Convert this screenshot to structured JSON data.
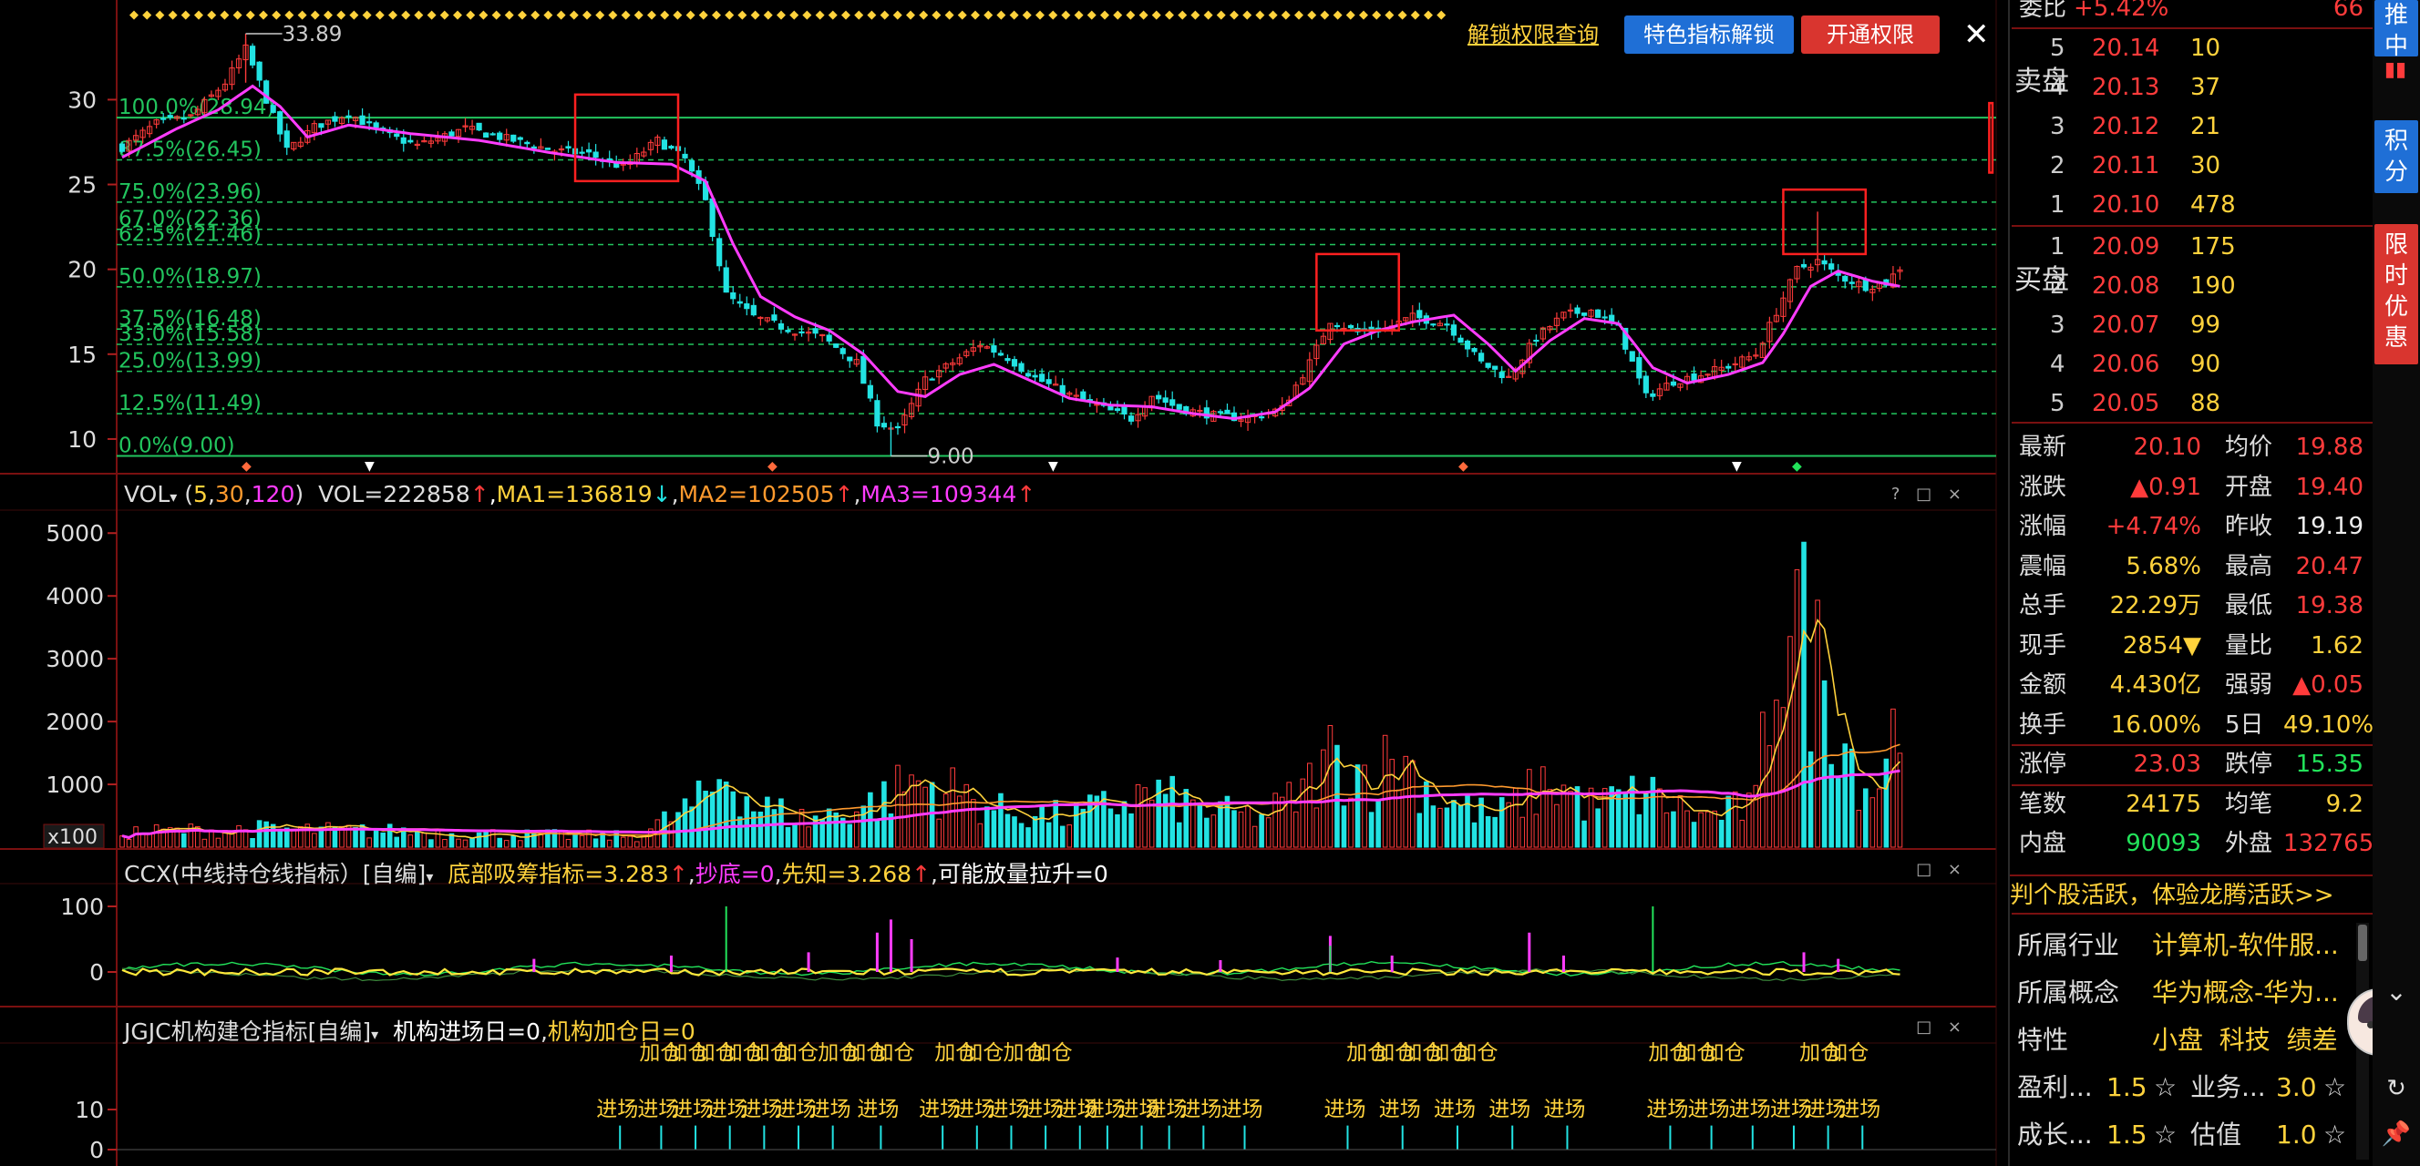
{
  "chart_data": [
    {
      "type": "candlestick",
      "title": "",
      "y_ticks": [
        10,
        15,
        20,
        25,
        30
      ],
      "ylim": [
        8.6,
        34.8
      ],
      "grid": false,
      "price_high_label": "33.89",
      "price_low_label": "9.00",
      "fib_levels": [
        {
          "label": "100.0%(28.94)",
          "value": 28.94
        },
        {
          "label": "87.5%(26.45)",
          "value": 26.45
        },
        {
          "label": "75.0%(23.96)",
          "value": 23.96
        },
        {
          "label": "67.0%(22.36)",
          "value": 22.36
        },
        {
          "label": "62.5%(21.46)",
          "value": 21.46
        },
        {
          "label": "50.0%(18.97)",
          "value": 18.97
        },
        {
          "label": "37.5%(16.48)",
          "value": 16.48
        },
        {
          "label": "33.0%(15.58)",
          "value": 15.58
        },
        {
          "label": "25.0%(13.99)",
          "value": 13.99
        },
        {
          "label": "12.5%(11.49)",
          "value": 11.49
        },
        {
          "label": "0.0%(9.00)",
          "value": 9.0
        }
      ],
      "close_approx": [
        {
          "i": 0,
          "v": 27.2
        },
        {
          "i": 5,
          "v": 28.6
        },
        {
          "i": 10,
          "v": 29.0
        },
        {
          "i": 15,
          "v": 31.0
        },
        {
          "i": 18,
          "v": 33.0
        },
        {
          "i": 21,
          "v": 30.0
        },
        {
          "i": 24,
          "v": 27.0
        },
        {
          "i": 28,
          "v": 28.4
        },
        {
          "i": 33,
          "v": 29.2
        },
        {
          "i": 38,
          "v": 28.0
        },
        {
          "i": 43,
          "v": 27.3
        },
        {
          "i": 50,
          "v": 28.3
        },
        {
          "i": 57,
          "v": 27.6
        },
        {
          "i": 63,
          "v": 27.0
        },
        {
          "i": 68,
          "v": 26.8
        },
        {
          "i": 73,
          "v": 26.0
        },
        {
          "i": 78,
          "v": 27.6
        },
        {
          "i": 82,
          "v": 26.5
        },
        {
          "i": 85,
          "v": 24.0
        },
        {
          "i": 88,
          "v": 18.5
        },
        {
          "i": 92,
          "v": 17.2
        },
        {
          "i": 97,
          "v": 16.5
        },
        {
          "i": 102,
          "v": 16.0
        },
        {
          "i": 107,
          "v": 14.5
        },
        {
          "i": 110,
          "v": 11.0
        },
        {
          "i": 113,
          "v": 10.5
        },
        {
          "i": 117,
          "v": 13.5
        },
        {
          "i": 121,
          "v": 14.5
        },
        {
          "i": 125,
          "v": 15.6
        },
        {
          "i": 129,
          "v": 14.8
        },
        {
          "i": 133,
          "v": 13.6
        },
        {
          "i": 138,
          "v": 12.6
        },
        {
          "i": 143,
          "v": 11.8
        },
        {
          "i": 147,
          "v": 11.2
        },
        {
          "i": 150,
          "v": 12.6
        },
        {
          "i": 154,
          "v": 11.8
        },
        {
          "i": 159,
          "v": 11.4
        },
        {
          "i": 164,
          "v": 11.2
        },
        {
          "i": 169,
          "v": 11.8
        },
        {
          "i": 173,
          "v": 14.5
        },
        {
          "i": 176,
          "v": 17.0
        },
        {
          "i": 180,
          "v": 16.3
        },
        {
          "i": 184,
          "v": 16.5
        },
        {
          "i": 188,
          "v": 17.2
        },
        {
          "i": 193,
          "v": 16.8
        },
        {
          "i": 198,
          "v": 14.5
        },
        {
          "i": 202,
          "v": 13.6
        },
        {
          "i": 206,
          "v": 16.0
        },
        {
          "i": 210,
          "v": 17.3
        },
        {
          "i": 214,
          "v": 17.6
        },
        {
          "i": 218,
          "v": 16.5
        },
        {
          "i": 222,
          "v": 12.5
        },
        {
          "i": 226,
          "v": 13.4
        },
        {
          "i": 230,
          "v": 13.8
        },
        {
          "i": 234,
          "v": 14.3
        },
        {
          "i": 238,
          "v": 15.0
        },
        {
          "i": 241,
          "v": 17.5
        },
        {
          "i": 244,
          "v": 20.0
        },
        {
          "i": 247,
          "v": 20.5
        },
        {
          "i": 250,
          "v": 19.6
        },
        {
          "i": 254,
          "v": 19.0
        },
        {
          "i": 257,
          "v": 19.2
        },
        {
          "i": 259,
          "v": 20.1
        }
      ],
      "ma_approx": [
        {
          "i": 0,
          "v": 26.6
        },
        {
          "i": 8,
          "v": 28.3
        },
        {
          "i": 14,
          "v": 29.4
        },
        {
          "i": 19,
          "v": 30.8
        },
        {
          "i": 23,
          "v": 29.6
        },
        {
          "i": 27,
          "v": 27.8
        },
        {
          "i": 33,
          "v": 28.5
        },
        {
          "i": 42,
          "v": 28.0
        },
        {
          "i": 52,
          "v": 27.6
        },
        {
          "i": 62,
          "v": 26.9
        },
        {
          "i": 72,
          "v": 26.3
        },
        {
          "i": 80,
          "v": 26.2
        },
        {
          "i": 85,
          "v": 25.2
        },
        {
          "i": 89,
          "v": 21.5
        },
        {
          "i": 93,
          "v": 18.4
        },
        {
          "i": 98,
          "v": 17.2
        },
        {
          "i": 103,
          "v": 16.4
        },
        {
          "i": 108,
          "v": 15.0
        },
        {
          "i": 113,
          "v": 12.8
        },
        {
          "i": 117,
          "v": 12.5
        },
        {
          "i": 122,
          "v": 13.8
        },
        {
          "i": 127,
          "v": 14.4
        },
        {
          "i": 132,
          "v": 13.5
        },
        {
          "i": 138,
          "v": 12.4
        },
        {
          "i": 144,
          "v": 12.0
        },
        {
          "i": 150,
          "v": 11.9
        },
        {
          "i": 156,
          "v": 11.5
        },
        {
          "i": 162,
          "v": 11.2
        },
        {
          "i": 168,
          "v": 11.6
        },
        {
          "i": 173,
          "v": 13.0
        },
        {
          "i": 178,
          "v": 15.6
        },
        {
          "i": 183,
          "v": 16.4
        },
        {
          "i": 188,
          "v": 16.9
        },
        {
          "i": 194,
          "v": 17.3
        },
        {
          "i": 199,
          "v": 15.6
        },
        {
          "i": 203,
          "v": 14.0
        },
        {
          "i": 208,
          "v": 15.8
        },
        {
          "i": 213,
          "v": 17.1
        },
        {
          "i": 218,
          "v": 16.8
        },
        {
          "i": 223,
          "v": 14.2
        },
        {
          "i": 228,
          "v": 13.3
        },
        {
          "i": 234,
          "v": 13.8
        },
        {
          "i": 239,
          "v": 14.5
        },
        {
          "i": 242,
          "v": 16.2
        },
        {
          "i": 246,
          "v": 19.0
        },
        {
          "i": 250,
          "v": 19.9
        },
        {
          "i": 255,
          "v": 19.3
        },
        {
          "i": 259,
          "v": 19.0
        }
      ],
      "n_bars": 260
    },
    {
      "type": "bar",
      "name": "VOL",
      "y_ticks": [
        1000,
        2000,
        3000,
        4000,
        5000
      ],
      "ylim": [
        0,
        5250
      ],
      "unit_label": "x100",
      "vol_approx": [
        {
          "i": 0,
          "v": 250
        },
        {
          "i": 20,
          "v": 300
        },
        {
          "i": 40,
          "v": 260
        },
        {
          "i": 60,
          "v": 200
        },
        {
          "i": 75,
          "v": 180
        },
        {
          "i": 85,
          "v": 800
        },
        {
          "i": 88,
          "v": 1300
        },
        {
          "i": 92,
          "v": 700
        },
        {
          "i": 100,
          "v": 450
        },
        {
          "i": 110,
          "v": 750
        },
        {
          "i": 115,
          "v": 1100
        },
        {
          "i": 122,
          "v": 900
        },
        {
          "i": 128,
          "v": 600
        },
        {
          "i": 138,
          "v": 500
        },
        {
          "i": 150,
          "v": 900
        },
        {
          "i": 158,
          "v": 600
        },
        {
          "i": 166,
          "v": 500
        },
        {
          "i": 172,
          "v": 900
        },
        {
          "i": 176,
          "v": 1500
        },
        {
          "i": 182,
          "v": 1200
        },
        {
          "i": 186,
          "v": 1500
        },
        {
          "i": 192,
          "v": 800
        },
        {
          "i": 200,
          "v": 500
        },
        {
          "i": 208,
          "v": 1100
        },
        {
          "i": 214,
          "v": 700
        },
        {
          "i": 222,
          "v": 900
        },
        {
          "i": 230,
          "v": 500
        },
        {
          "i": 238,
          "v": 700
        },
        {
          "i": 241,
          "v": 3500
        },
        {
          "i": 243,
          "v": 4200
        },
        {
          "i": 246,
          "v": 3200
        },
        {
          "i": 249,
          "v": 2600
        },
        {
          "i": 252,
          "v": 1500
        },
        {
          "i": 255,
          "v": 900
        },
        {
          "i": 258,
          "v": 1900
        },
        {
          "i": 259,
          "v": 2200
        }
      ]
    }
  ],
  "header": {
    "buttons": {
      "query": "解锁权限查询",
      "unlock": "特色指标解锁",
      "open": "开通权限",
      "close": "✕"
    }
  },
  "vol_header": {
    "name": "VOL",
    "params_open": "(",
    "p1": "5",
    "comma1": ",",
    "p2": "30",
    "comma2": ",",
    "p3": "120",
    "params_close": ")",
    "vol": "VOL=222858",
    "vol_arrow": "↑",
    "ma1": "MA1=136819",
    "ma1_arrow": "↓",
    "ma2": "MA2=102505",
    "ma2_arrow": "↑",
    "ma3": "MA3=109344",
    "ma3_arrow": "↑",
    "controls": "? □ ×"
  },
  "ccx_header": {
    "name": "CCX(中线持仓线指标）[自编]",
    "v1": "底部吸筹指标=3.283",
    "v1_arrow": "↑",
    "v2": "抄底=0",
    "v3": "先知=3.268",
    "v3_arrow": "↑",
    "v4": "可能放量拉升=0",
    "y_ticks": [
      "100",
      "0"
    ],
    "controls": "□ ×"
  },
  "jgjc_header": {
    "name": "JGJC机构建仓指标[自编]",
    "v1": "机构进场日=0",
    "v2": "机构加仓日=0",
    "y_ticks": [
      "10",
      "0"
    ],
    "signal_add": "加仓",
    "signal_enter": "进场",
    "controls": "□ ×"
  },
  "order_book": {
    "top_label": "委比",
    "top_value": "+5.42%",
    "top_right": "66",
    "sell_side": "卖盘",
    "buy_side": "买盘",
    "sell": [
      {
        "idx": "5",
        "price": "20.14",
        "vol": "10"
      },
      {
        "idx": "4",
        "price": "20.13",
        "vol": "37"
      },
      {
        "idx": "3",
        "price": "20.12",
        "vol": "21"
      },
      {
        "idx": "2",
        "price": "20.11",
        "vol": "30"
      },
      {
        "idx": "1",
        "price": "20.10",
        "vol": "478"
      }
    ],
    "buy": [
      {
        "idx": "1",
        "price": "20.09",
        "vol": "175"
      },
      {
        "idx": "2",
        "price": "20.08",
        "vol": "190"
      },
      {
        "idx": "3",
        "price": "20.07",
        "vol": "99"
      },
      {
        "idx": "4",
        "price": "20.06",
        "vol": "90"
      },
      {
        "idx": "5",
        "price": "20.05",
        "vol": "88"
      }
    ]
  },
  "quote": [
    {
      "l": "最新",
      "lv": "20.10",
      "lc": "red",
      "r": "均价",
      "rv": "19.88",
      "rc": "red"
    },
    {
      "l": "涨跌",
      "lv": "▲0.91",
      "lc": "red",
      "r": "开盘",
      "rv": "19.40",
      "rc": "red"
    },
    {
      "l": "涨幅",
      "lv": "+4.74%",
      "lc": "red",
      "r": "昨收",
      "rv": "19.19",
      "rc": "white"
    },
    {
      "l": "震幅",
      "lv": "5.68%",
      "lc": "yellow",
      "r": "最高",
      "rv": "20.47",
      "rc": "red"
    },
    {
      "l": "总手",
      "lv": "22.29万",
      "lc": "yellow",
      "r": "最低",
      "rv": "19.38",
      "rc": "red"
    },
    {
      "l": "现手",
      "lv": "2854▼",
      "lc": "yellow",
      "r": "量比",
      "rv": "1.62",
      "rc": "yellow"
    },
    {
      "l": "金额",
      "lv": "4.430亿",
      "lc": "yellow",
      "r": "强弱",
      "rv": "▲0.05",
      "rc": "red"
    },
    {
      "l": "换手",
      "lv": "16.00%",
      "lc": "yellow",
      "r": "5日",
      "rv": "49.10%",
      "rc": "yellow"
    },
    {
      "l": "涨停",
      "lv": "23.03",
      "lc": "red",
      "r": "跌停",
      "rv": "15.35",
      "rc": "green"
    },
    {
      "l": "笔数",
      "lv": "24175",
      "lc": "yellow",
      "r": "均笔",
      "rv": "9.2",
      "rc": "yellow"
    },
    {
      "l": "内盘",
      "lv": "90093",
      "lc": "green",
      "r": "外盘",
      "rv": "132765",
      "rc": "red"
    }
  ],
  "banner": "判个股活跃，体验龙腾活跃>>",
  "info": {
    "industry_label": "所属行业",
    "industry_value": "计算机-软件服...",
    "concept_label": "所属概念",
    "concept_value": "华为概念-华为...",
    "feature_label": "特性",
    "feature_values": "小盘  科技  绩差",
    "profit_label": "盈利...",
    "profit_value": "1.5",
    "business_label": "业务...",
    "business_value": "3.0",
    "growth_label": "成长...",
    "growth_value": "1.5",
    "valuation_label": "估值",
    "valuation_value": "1.0",
    "star": "☆"
  },
  "side_tabs": [
    "推中",
    "积分",
    "限时优惠"
  ],
  "colors": {
    "up": "#ff3b3b",
    "down": "#22e3e3",
    "ma": "#ff3cff",
    "fib": "#22c55e",
    "box": "#ff2020",
    "yellow": "#ffd23c"
  }
}
